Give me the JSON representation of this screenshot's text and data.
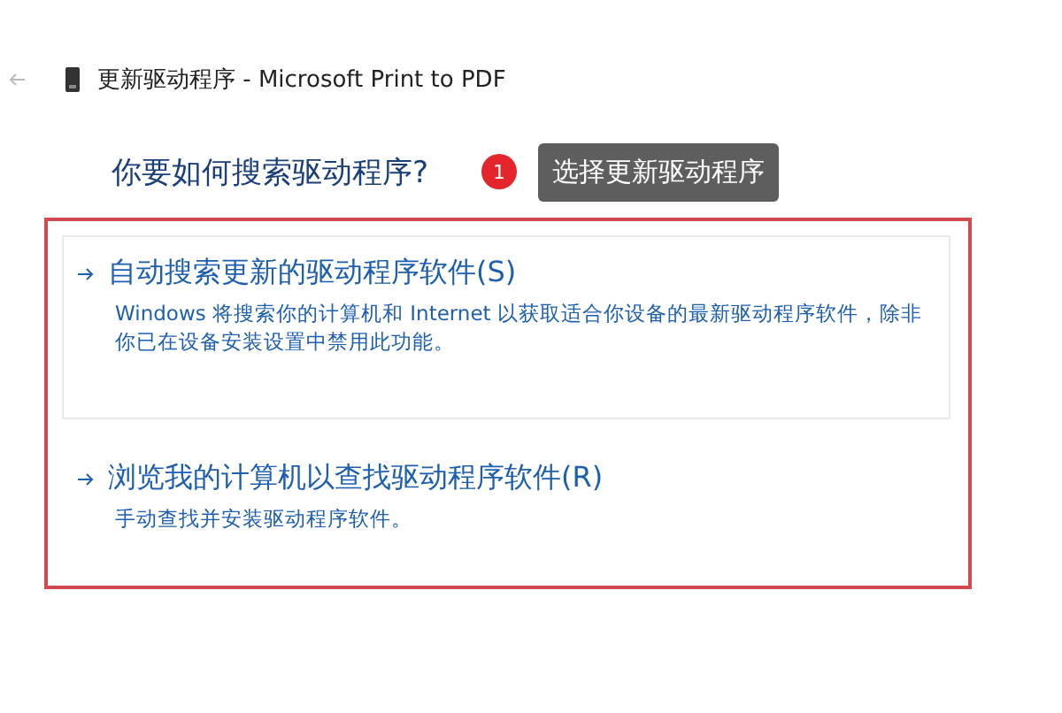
{
  "window": {
    "title": "更新驱动程序 - Microsoft Print to PDF"
  },
  "heading": "你要如何搜索驱动程序?",
  "callout": {
    "number": "1",
    "text": "选择更新驱动程序"
  },
  "options": [
    {
      "title": "自动搜索更新的驱动程序软件(S)",
      "description": "Windows 将搜索你的计算机和 Internet 以获取适合你设备的最新驱动程序软件，除非你已在设备安装设置中禁用此功能。",
      "selected": true
    },
    {
      "title": "浏览我的计算机以查找驱动程序软件(R)",
      "description": "手动查找并安装驱动程序软件。",
      "selected": false
    }
  ]
}
